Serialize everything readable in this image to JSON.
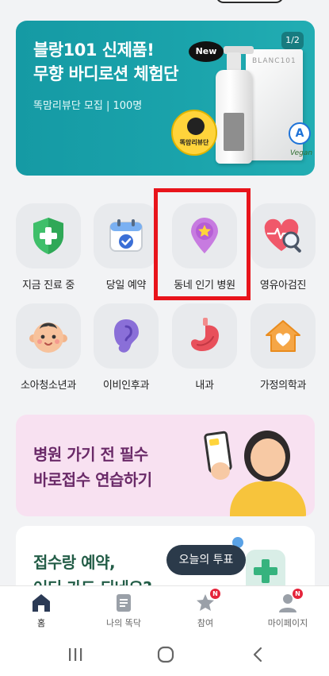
{
  "banner": {
    "title_line1": "블랑101 신제품!",
    "title_line2": "무향 바디로션 체험단",
    "subtitle": "똑맘리뷰단 모집 | 100명",
    "page_indicator": "1/2",
    "new_badge": "New",
    "product_brand": "BLANC101",
    "mascot_label": "똑맘리뷰단",
    "a_badge": "A",
    "vegan_mark": "Vegan"
  },
  "categories": [
    {
      "label": "지금 진료 중",
      "icon": "shield-plus-icon"
    },
    {
      "label": "당일 예약",
      "icon": "calendar-check-icon"
    },
    {
      "label": "동네 인기 병원",
      "icon": "location-star-icon"
    },
    {
      "label": "영유아검진",
      "icon": "heart-magnifier-icon"
    },
    {
      "label": "소아청소년과",
      "icon": "baby-face-icon"
    },
    {
      "label": "이비인후과",
      "icon": "ear-icon"
    },
    {
      "label": "내과",
      "icon": "stomach-icon"
    },
    {
      "label": "가정의학과",
      "icon": "house-heart-icon"
    }
  ],
  "promo_pink": {
    "line1": "병원 가기 전 필수",
    "line2": "바로접수 연습하기",
    "phone_label": "똑닥"
  },
  "promo_white": {
    "line1": "접수랑 예약,",
    "line2": "어디 가도 되네요?"
  },
  "tooltip": {
    "label": "오늘의 투표"
  },
  "bottom_nav": [
    {
      "label": "홈",
      "icon": "home-icon",
      "active": true
    },
    {
      "label": "나의 똑닥",
      "icon": "document-icon",
      "active": false
    },
    {
      "label": "참여",
      "icon": "star-bubble-icon",
      "active": false,
      "badge": "N"
    },
    {
      "label": "마이페이지",
      "icon": "person-icon",
      "active": false,
      "badge": "N"
    }
  ],
  "colors": {
    "banner_bg": "#1aa3ab",
    "highlight": "#e8141b",
    "pink_card": "#f8e1f1",
    "badge_red": "#e5243b"
  }
}
